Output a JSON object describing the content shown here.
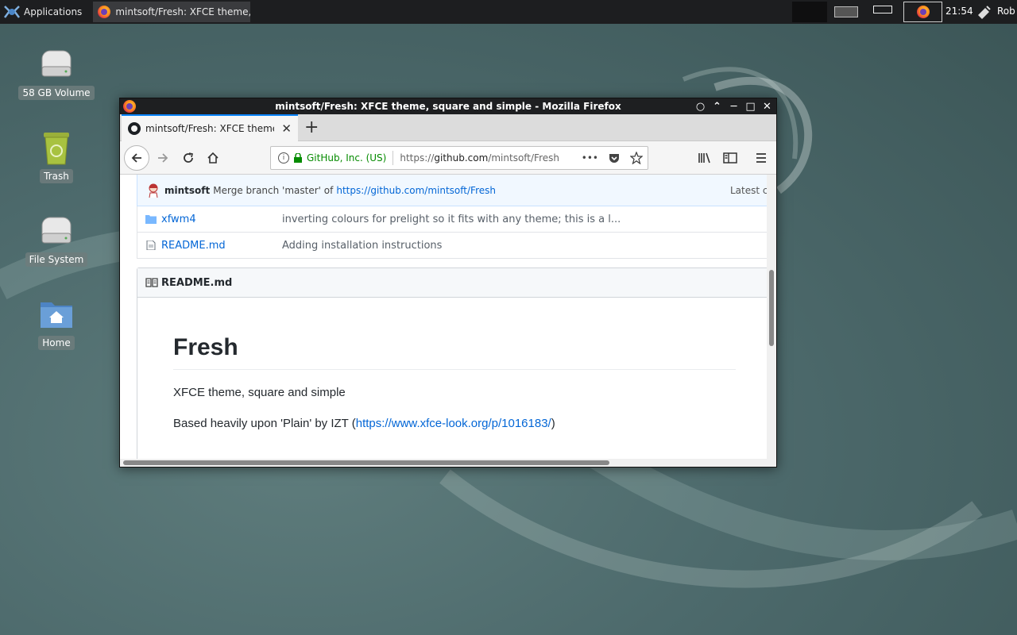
{
  "panel": {
    "applications_label": "Applications",
    "task_title": "mintsoft/Fresh: XFCE theme,...",
    "clock": "21:54",
    "user": "Rob"
  },
  "desktop": {
    "icons": [
      {
        "label": "58 GB Volume",
        "icon": "drive-icon"
      },
      {
        "label": "Trash",
        "icon": "trash-icon"
      },
      {
        "label": "File System",
        "icon": "drive-icon"
      },
      {
        "label": "Home",
        "icon": "home-folder-icon"
      }
    ]
  },
  "window": {
    "title": "mintsoft/Fresh: XFCE theme, square and simple - Mozilla Firefox",
    "tab_title": "mintsoft/Fresh: XFCE theme,",
    "url_org": "GitHub, Inc. (US)",
    "url_scheme": "https://",
    "url_host": "github.com",
    "url_path": "/mintsoft/Fresh"
  },
  "repo": {
    "commit": {
      "author": "mintsoft",
      "message": "Merge branch 'master' of",
      "link": "https://github.com/mintsoft/Fresh",
      "latest": "Latest c"
    },
    "files": [
      {
        "name": "xfwm4",
        "type": "folder",
        "message": "inverting colours for prelight so it fits with any theme; this is a l..."
      },
      {
        "name": "README.md",
        "type": "file",
        "message": "Adding installation instructions"
      }
    ]
  },
  "readme": {
    "header": "README.md",
    "h1": "Fresh",
    "p1": "XFCE theme, square and simple",
    "p2_prefix": "Based heavily upon 'Plain' by IZT (",
    "p2_link": "https://www.xfce-look.org/p/1016183/",
    "p2_suffix": ")"
  },
  "colors": {
    "accent": "#0a84ff",
    "link": "#0366d6",
    "secure_green": "#058b00",
    "panel_bg": "#1d1e20"
  }
}
